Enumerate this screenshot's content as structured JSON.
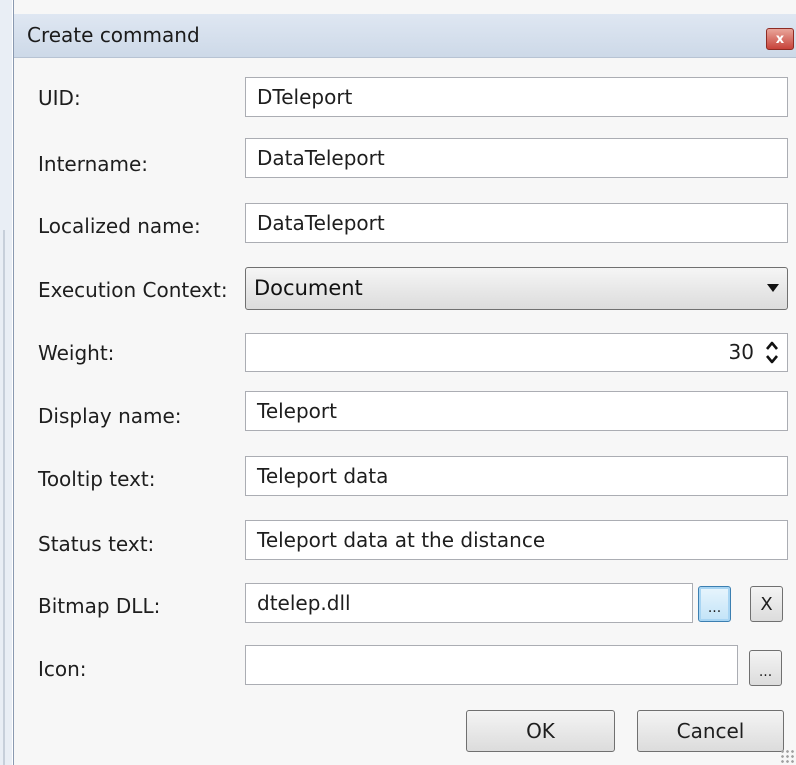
{
  "window": {
    "title": "Create command",
    "close_glyph": "x"
  },
  "fields": {
    "uid": {
      "label": "UID:",
      "value": "DTeleport"
    },
    "intername": {
      "label": "Intername:",
      "value": "DataTeleport"
    },
    "localized_name": {
      "label": "Localized name:",
      "value": "DataTeleport"
    },
    "execution_context": {
      "label": "Execution Context:",
      "value": "Document"
    },
    "weight": {
      "label": "Weight:",
      "value": "30"
    },
    "display_name": {
      "label": "Display name:",
      "value": "Teleport"
    },
    "tooltip_text": {
      "label": "Tooltip text:",
      "value": "Teleport data"
    },
    "status_text": {
      "label": "Status text:",
      "value": "Teleport data at the distance"
    },
    "bitmap_dll": {
      "label": "Bitmap DLL:",
      "value": "dtelep.dll",
      "browse_label": "...",
      "clear_label": "X"
    },
    "icon": {
      "label": "Icon:",
      "value": "",
      "browse_label": "..."
    }
  },
  "buttons": {
    "ok": "OK",
    "cancel": "Cancel"
  },
  "icons": {
    "dropdown": "chevron-down-icon",
    "spin_up": "arrow-up-icon",
    "spin_down": "arrow-down-icon",
    "close": "close-icon"
  }
}
